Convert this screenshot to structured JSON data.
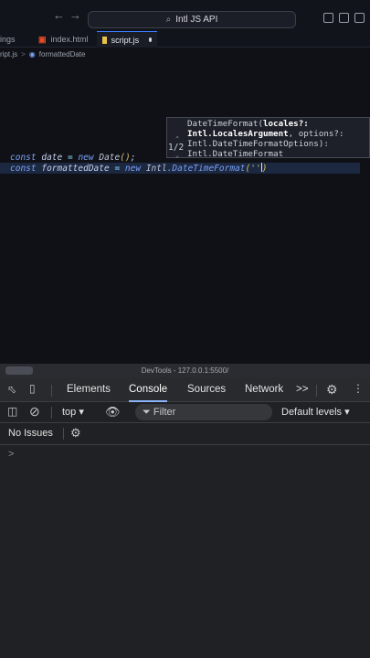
{
  "titlebar": {
    "back_icon": "arrow-left-icon",
    "forward_icon": "arrow-right-icon",
    "search_text": "Intl JS API",
    "layout_icons": [
      "toggle-primary-sidebar-icon",
      "toggle-panel-icon",
      "toggle-secondary-sidebar-icon"
    ]
  },
  "tabs": [
    {
      "label": "ings"
    },
    {
      "label": "index.html"
    },
    {
      "label": "script.js"
    }
  ],
  "breadcrumb": {
    "file": "ript.js",
    "sep": ">",
    "symbol": "formattedDate"
  },
  "code": {
    "line1": {
      "kw1": "const",
      "name": "date",
      "eq": "=",
      "kw2": "new",
      "cls": "Date",
      "call": "()",
      "semi": ";"
    },
    "line2": {
      "kw1": "const",
      "name": "formattedDate",
      "eq": "=",
      "kw2": "new",
      "cls": "Intl",
      "member": ".DateTimeFormat",
      "open": "(",
      "str": "''",
      "close": ")"
    }
  },
  "signature_hint": {
    "counter": "1/2",
    "lines": [
      {
        "pre": "DateTimeFormat(",
        "bold": "locales?:",
        "post": ""
      },
      {
        "pre": "",
        "bold": "Intl.LocalesArgument",
        "post": ", options?:"
      },
      {
        "pre": "Intl.DateTimeFormatOptions):",
        "bold": "",
        "post": ""
      },
      {
        "pre": "Intl.DateTimeFormat",
        "bold": "",
        "post": ""
      }
    ]
  },
  "devtools": {
    "window_title": "DevTools - 127.0.0.1:5500/",
    "tabs": [
      "Elements",
      "Console",
      "Sources",
      "Network"
    ],
    "active_tab": "Console",
    "more_tabs": ">>",
    "context": "top",
    "filter_placeholder": "Filter",
    "levels": "Default levels",
    "issues": "No Issues",
    "prompt": ">"
  }
}
